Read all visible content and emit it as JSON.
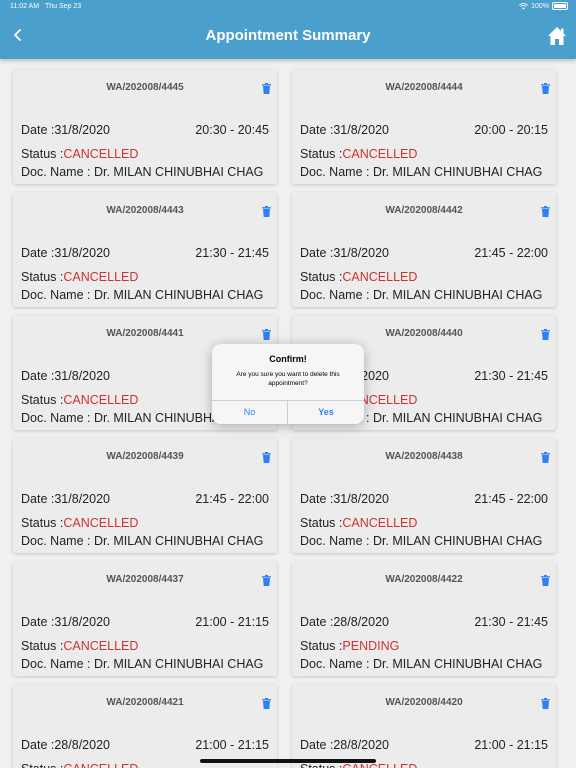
{
  "status_bar": {
    "time": "11:02 AM",
    "date": "Thu Sep 23",
    "battery": "100%"
  },
  "navbar": {
    "title": "Appointment Summary"
  },
  "labels": {
    "date_prefix": "Date :",
    "status_prefix": "Status :",
    "doc_prefix": "Doc. Name : "
  },
  "colors": {
    "header": "#4a9fcd",
    "status_cancelled": "#d32f2f",
    "status_pending": "#d32f2f",
    "dialog_button": "#2f7ff5"
  },
  "appointments": [
    {
      "id": "WA/202008/4445",
      "date": "31/8/2020",
      "time": "20:30 - 20:45",
      "status": "CANCELLED",
      "doctor": "Dr. MILAN CHINUBHAI CHAG"
    },
    {
      "id": "WA/202008/4444",
      "date": "31/8/2020",
      "time": "20:00 - 20:15",
      "status": "CANCELLED",
      "doctor": "Dr. MILAN CHINUBHAI CHAG"
    },
    {
      "id": "WA/202008/4443",
      "date": "31/8/2020",
      "time": "21:30 - 21:45",
      "status": "CANCELLED",
      "doctor": "Dr. MILAN CHINUBHAI CHAG"
    },
    {
      "id": "WA/202008/4442",
      "date": "31/8/2020",
      "time": "21:45 - 22:00",
      "status": "CANCELLED",
      "doctor": "Dr. MILAN CHINUBHAI CHAG"
    },
    {
      "id": "WA/202008/4441",
      "date": "31/8/2020",
      "time": "21",
      "status": "CANCELLED",
      "doctor": "Dr. MILAN CHINUBHAI CHAG"
    },
    {
      "id": "WA/202008/4440",
      "date": "31/8/2020",
      "time": "21:30 - 21:45",
      "status": "CANCELLED",
      "doctor": "Dr. MILAN CHINUBHAI CHAG"
    },
    {
      "id": "WA/202008/4439",
      "date": "31/8/2020",
      "time": "21:45 - 22:00",
      "status": "CANCELLED",
      "doctor": "Dr. MILAN CHINUBHAI CHAG"
    },
    {
      "id": "WA/202008/4438",
      "date": "31/8/2020",
      "time": "21:45 - 22:00",
      "status": "CANCELLED",
      "doctor": "Dr. MILAN CHINUBHAI CHAG"
    },
    {
      "id": "WA/202008/4437",
      "date": "31/8/2020",
      "time": "21:00 - 21:15",
      "status": "CANCELLED",
      "doctor": "Dr. MILAN CHINUBHAI CHAG"
    },
    {
      "id": "WA/202008/4422",
      "date": "28/8/2020",
      "time": "21:30 - 21:45",
      "status": "PENDING",
      "doctor": "Dr. MILAN CHINUBHAI CHAG"
    },
    {
      "id": "WA/202008/4421",
      "date": "28/8/2020",
      "time": "21:00 - 21:15",
      "status": "CANCELLED",
      "doctor": "Dr. MILAN CHINUBHAI CHAG"
    },
    {
      "id": "WA/202008/4420",
      "date": "28/8/2020",
      "time": "21:00 - 21:15",
      "status": "CANCELLED",
      "doctor": "Dr. MILAN CHINUBHAI CHAG"
    }
  ],
  "dialog": {
    "title": "Confirm!",
    "message": "Are you sure you want to delete this appointment?",
    "no_label": "No",
    "yes_label": "Yes"
  }
}
